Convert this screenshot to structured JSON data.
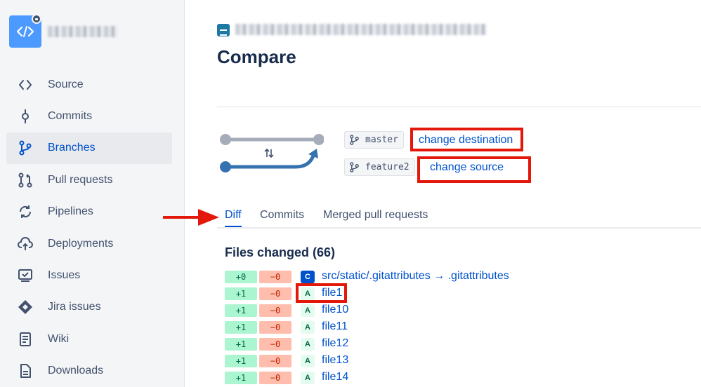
{
  "sidebar": {
    "repo_name_redacted": "",
    "items": [
      {
        "label": "Source",
        "icon": "code-icon"
      },
      {
        "label": "Commits",
        "icon": "commit-icon"
      },
      {
        "label": "Branches",
        "icon": "branch-icon",
        "active": true
      },
      {
        "label": "Pull requests",
        "icon": "pull-request-icon"
      },
      {
        "label": "Pipelines",
        "icon": "pipelines-icon"
      },
      {
        "label": "Deployments",
        "icon": "deployments-icon"
      },
      {
        "label": "Issues",
        "icon": "issues-icon"
      },
      {
        "label": "Jira issues",
        "icon": "jira-icon"
      },
      {
        "label": "Wiki",
        "icon": "wiki-icon"
      },
      {
        "label": "Downloads",
        "icon": "downloads-icon"
      }
    ]
  },
  "header": {
    "title": "Compare"
  },
  "compare": {
    "destination_branch": "master",
    "source_branch": "feature2",
    "change_destination": "change destination",
    "change_source": "change source"
  },
  "tabs": [
    {
      "label": "Diff",
      "active": true
    },
    {
      "label": "Commits",
      "active": false
    },
    {
      "label": "Merged pull requests",
      "active": false
    }
  ],
  "files": {
    "heading": "Files changed (66)",
    "rows": [
      {
        "added": "+0",
        "removed": "−0",
        "status": "C",
        "name": "src/static/.gitattributes → .gitattributes"
      },
      {
        "added": "+1",
        "removed": "−0",
        "status": "A",
        "name": "file1"
      },
      {
        "added": "+1",
        "removed": "−0",
        "status": "A",
        "name": "file10"
      },
      {
        "added": "+1",
        "removed": "−0",
        "status": "A",
        "name": "file11"
      },
      {
        "added": "+1",
        "removed": "−0",
        "status": "A",
        "name": "file12"
      },
      {
        "added": "+1",
        "removed": "−0",
        "status": "A",
        "name": "file13"
      },
      {
        "added": "+1",
        "removed": "−0",
        "status": "A",
        "name": "file14"
      }
    ]
  },
  "colors": {
    "accent": "#0052CC",
    "annotation_red": "#E3170A",
    "added_bg": "#ABF5D1",
    "removed_bg": "#FFBDAD",
    "graph_gray": "#A5ADBA",
    "graph_blue": "#3572B0"
  }
}
